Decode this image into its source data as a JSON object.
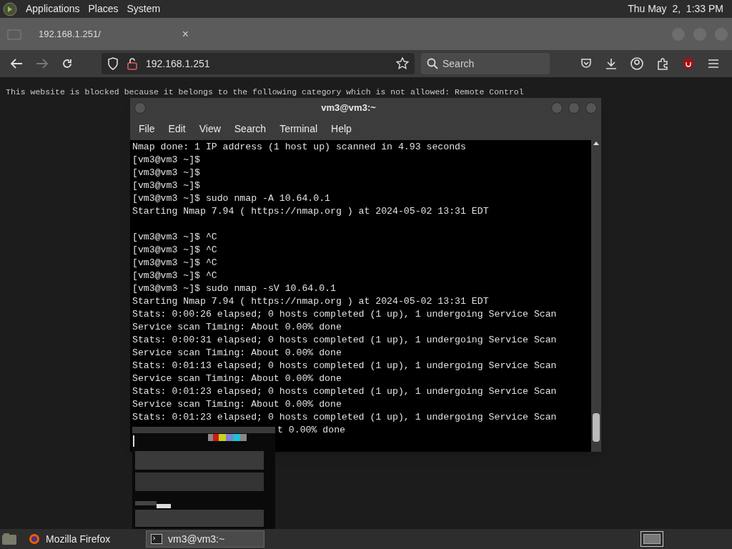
{
  "top_panel": {
    "menus": [
      "Applications",
      "Places",
      "System"
    ],
    "clock": "Thu May  2,  1:33 PM"
  },
  "browser": {
    "tab": {
      "title": "192.168.1.251/",
      "close": "×"
    },
    "url": "192.168.1.251",
    "search": {
      "placeholder": "Search"
    },
    "message": "This website is blocked because it belongs to the following category which is not allowed: Remote Control"
  },
  "terminal": {
    "title": "vm3@vm3:~",
    "menu": [
      "File",
      "Edit",
      "View",
      "Search",
      "Terminal",
      "Help"
    ],
    "blocks": [
      [
        "Nmap done: 1 IP address (1 host up) scanned in 4.93 seconds",
        "[vm3@vm3 ~]$",
        "[vm3@vm3 ~]$",
        "[vm3@vm3 ~]$",
        "[vm3@vm3 ~]$ sudo nmap -A 10.64.0.1",
        "Starting Nmap 7.94 ( https://nmap.org ) at 2024-05-02 13:31 EDT"
      ],
      [
        "[vm3@vm3 ~]$ ^C",
        "[vm3@vm3 ~]$ ^C",
        "[vm3@vm3 ~]$ ^C",
        "[vm3@vm3 ~]$ ^C",
        "[vm3@vm3 ~]$ sudo nmap -sV 10.64.0.1",
        "Starting Nmap 7.94 ( https://nmap.org ) at 2024-05-02 13:31 EDT",
        "Stats: 0:00:26 elapsed; 0 hosts completed (1 up), 1 undergoing Service Scan",
        "Service scan Timing: About 0.00% done",
        "Stats: 0:00:31 elapsed; 0 hosts completed (1 up), 1 undergoing Service Scan",
        "Service scan Timing: About 0.00% done",
        "Stats: 0:01:13 elapsed; 0 hosts completed (1 up), 1 undergoing Service Scan",
        "Service scan Timing: About 0.00% done",
        "Stats: 0:01:23 elapsed; 0 hosts completed (1 up), 1 undergoing Service Scan",
        "Service scan Timing: About 0.00% done",
        "Stats: 0:01:23 elapsed; 0 hosts completed (1 up), 1 undergoing Service Scan"
      ]
    ],
    "partial_line": "t 0.00% done"
  },
  "taskbar": {
    "items": [
      {
        "label": "Mozilla Firefox",
        "selected": false
      },
      {
        "label": "vm3@vm3:~",
        "selected": true
      }
    ]
  }
}
